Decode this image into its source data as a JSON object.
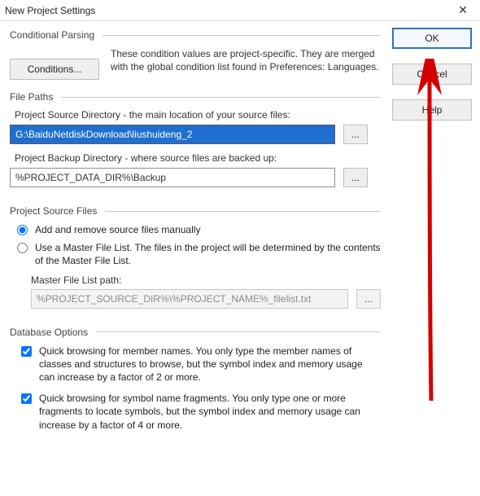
{
  "window": {
    "title": "New Project Settings",
    "close_glyph": "✕"
  },
  "buttons": {
    "ok": "OK",
    "cancel": "Cancel",
    "help": "Help",
    "conditions": "Conditions...",
    "browse": "..."
  },
  "sections": {
    "conditional_parsing": "Conditional Parsing",
    "file_paths": "File Paths",
    "project_source_files": "Project Source Files",
    "database_options": "Database Options"
  },
  "conditional_parsing": {
    "description": "These condition values are project-specific.  They are merged with the global condition list found in Preferences: Languages."
  },
  "file_paths": {
    "source_dir_label": "Project Source Directory - the main location of your source files:",
    "source_dir_value": "G:\\BaiduNetdiskDownload\\liushuideng_2",
    "backup_dir_label": "Project Backup Directory - where source files are backed up:",
    "backup_dir_value": "%PROJECT_DATA_DIR%\\Backup"
  },
  "project_source_files": {
    "radio_manual": "Add and remove source files manually",
    "radio_master": "Use a Master File List. The files in the project will be determined by the contents of the Master File List.",
    "master_label": "Master File List path:",
    "master_value": "%PROJECT_SOURCE_DIR%\\%PROJECT_NAME%_filelist.txt"
  },
  "database_options": {
    "quick_members": "Quick browsing for member names.  You only type the member names of classes and structures to browse, but the symbol index and memory usage can increase by a factor of 2 or more.",
    "quick_fragments": "Quick browsing for symbol name fragments.  You only type one or more fragments to locate symbols, but the symbol index and memory usage can increase by a factor of 4 or more."
  }
}
